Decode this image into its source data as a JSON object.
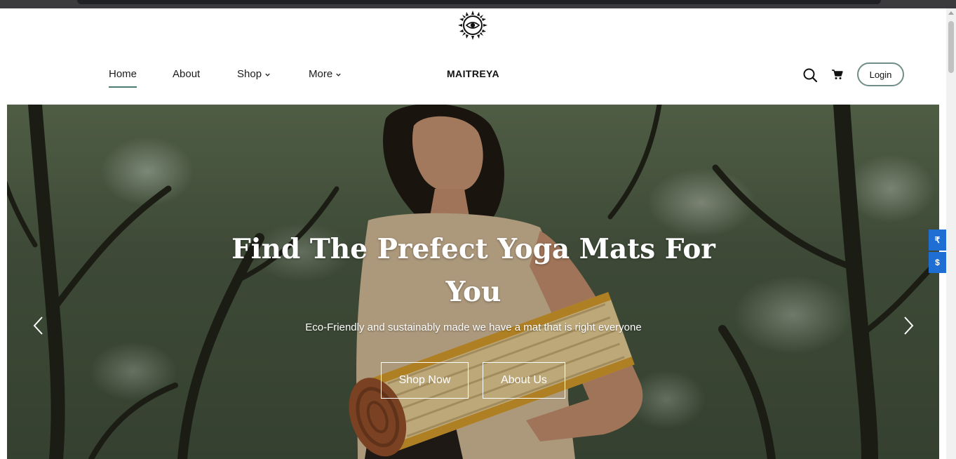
{
  "header": {
    "brand_name": "MAITREYA",
    "logo_icon": "sun-eye-logo",
    "nav": [
      {
        "label": "Home",
        "active": true
      },
      {
        "label": "About"
      },
      {
        "label": "Shop",
        "has_dropdown": true
      },
      {
        "label": "More",
        "has_dropdown": true
      }
    ],
    "search_icon": "search-icon",
    "cart_icon": "cart-icon",
    "login_label": "Login"
  },
  "hero": {
    "title": "Find The Prefect Yoga Mats For You",
    "subtitle": "Eco-Friendly and sustainably made we have a mat that is right everyone",
    "primary_button": "Shop Now",
    "secondary_button": "About Us"
  },
  "currency_switcher": {
    "items": [
      "₹",
      "$"
    ],
    "color": "#1f6ed4"
  },
  "colors": {
    "accent": "#4b7a73",
    "login_border": "#6f8e88"
  }
}
